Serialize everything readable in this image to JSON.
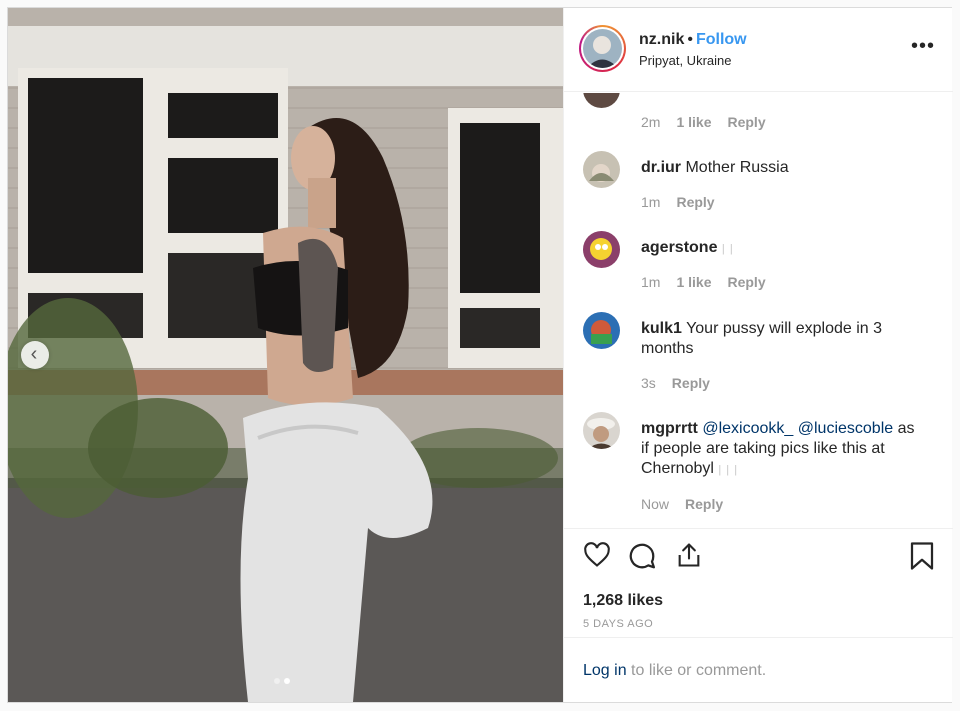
{
  "post": {
    "username": "nz.nik",
    "separator": "•",
    "follow_label": "Follow",
    "location": "Pripyat, Ukraine",
    "more_icon": "more-options-icon",
    "more_label": "•••"
  },
  "carousel": {
    "prev_icon": "chevron-left-icon",
    "prev_glyph": "‹",
    "slide_count": 2,
    "active_slide": 2
  },
  "comments": [
    {
      "username": "",
      "text": "",
      "time": "2m",
      "likes": "1 like",
      "reply": "Reply"
    },
    {
      "username": "dr.iur",
      "text": "Mother Russia",
      "time": "1m",
      "likes": "",
      "reply": "Reply"
    },
    {
      "username": "agerstone",
      "text": "",
      "faint": "| |",
      "time": "1m",
      "likes": "1 like",
      "reply": "Reply"
    },
    {
      "username": "kulk1",
      "text": "Your pussy will explode in 3 months",
      "time": "3s",
      "likes": "",
      "reply": "Reply"
    },
    {
      "username": "mgprrtt",
      "mention1": "@lexicookk_",
      "mention2": "@luciescoble",
      "text": "as if people are taking pics like this at Chernobyl",
      "faint": "| | |",
      "time": "Now",
      "likes": "",
      "reply": "Reply"
    }
  ],
  "actions": {
    "like_icon": "heart-icon",
    "comment_icon": "comment-icon",
    "share_icon": "share-icon",
    "save_icon": "bookmark-icon",
    "likes_count": "1,268 likes",
    "date": "5 DAYS AGO"
  },
  "footer": {
    "login_label": "Log in",
    "rest_text": " to like or comment."
  },
  "colors": {
    "accent": "#3897f0",
    "link": "#003569",
    "muted": "#999999"
  }
}
